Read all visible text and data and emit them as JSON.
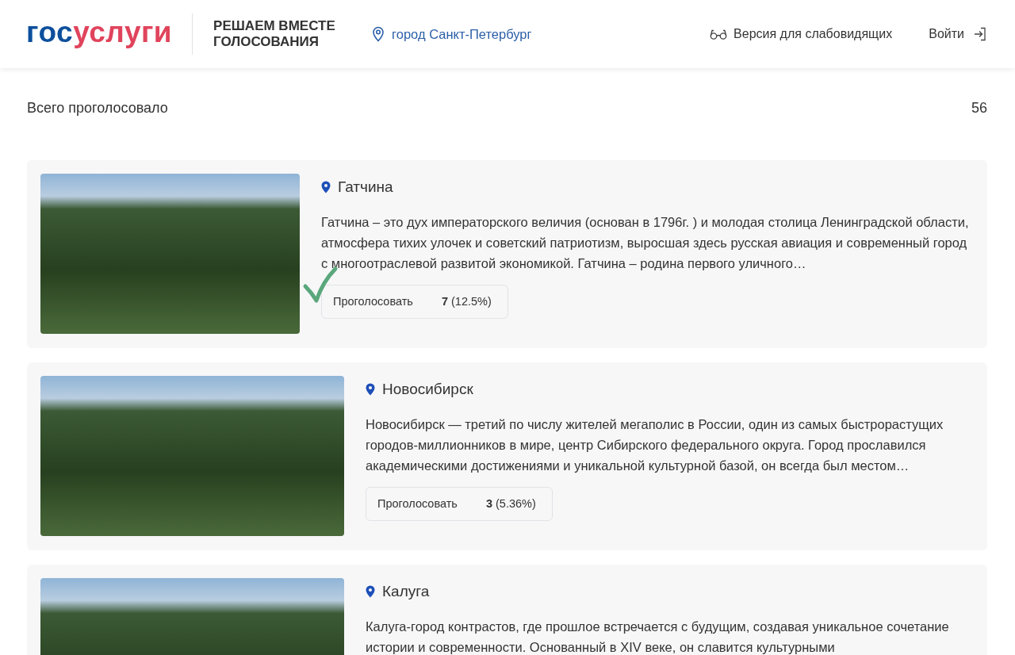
{
  "header": {
    "logo": {
      "first": "гос",
      "second": "услуги"
    },
    "project_title": "РЕШАЕМ ВМЕСТЕ ГОЛОСОВАНИЯ",
    "city": "город Санкт-Петербург",
    "accessibility_link": "Версия для слабовидящих",
    "login": "Войти"
  },
  "total": {
    "label": "Всего проголосовало",
    "value": "56"
  },
  "cards": [
    {
      "name": "Гатчина",
      "marked": true,
      "description": "Гатчина – это дух императорского величия (основан в 1796г. ) и молодая столица Ленинградской области, атмосфера тихих улочек и советский патриотизм, выросшая здесь русская авиация и современный город с многоотраслевой развитой экономикой. Гатчина – родина первого уличного…",
      "vote_button": "Проголосовать",
      "votes": "7",
      "share": "(12.5%)"
    },
    {
      "name": "Новосибирск",
      "marked": false,
      "description": "Новосибирск — третий по числу жителей мегаполис в России, один из самых быстрорастущих городов-миллионников в мире, центр Сибирского федерального округа. Город прославился академическими достижениями и уникальной культурной базой, он всегда был местом…",
      "vote_button": "Проголосовать",
      "votes": "3",
      "share": "(5.36%)"
    },
    {
      "name": "Калуга",
      "marked": false,
      "description": "Калуга-город контрастов, где прошлое встречается с будущим, создавая уникальное сочетание истории и современности. Основанный в XIV веке, он славится культурными"
    }
  ]
}
